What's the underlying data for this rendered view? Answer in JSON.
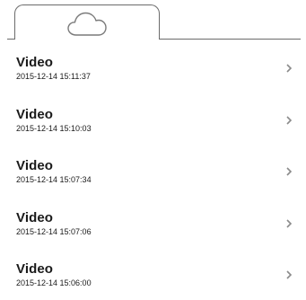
{
  "tabs": [
    {
      "icon": "cloud-icon",
      "active": true
    }
  ],
  "videos": [
    {
      "title": "Video",
      "date": "2015-12-14 15:11:37"
    },
    {
      "title": "Video",
      "date": "2015-12-14 15:10:03"
    },
    {
      "title": "Video",
      "date": "2015-12-14 15:07:34"
    },
    {
      "title": "Video",
      "date": "2015-12-14 15:07:06"
    },
    {
      "title": "Video",
      "date": "2015-12-14 15:06:00"
    }
  ],
  "colors": {
    "line": "#6b6b6b",
    "text": "#1a1a1a",
    "chevron": "#8a8a8a"
  }
}
